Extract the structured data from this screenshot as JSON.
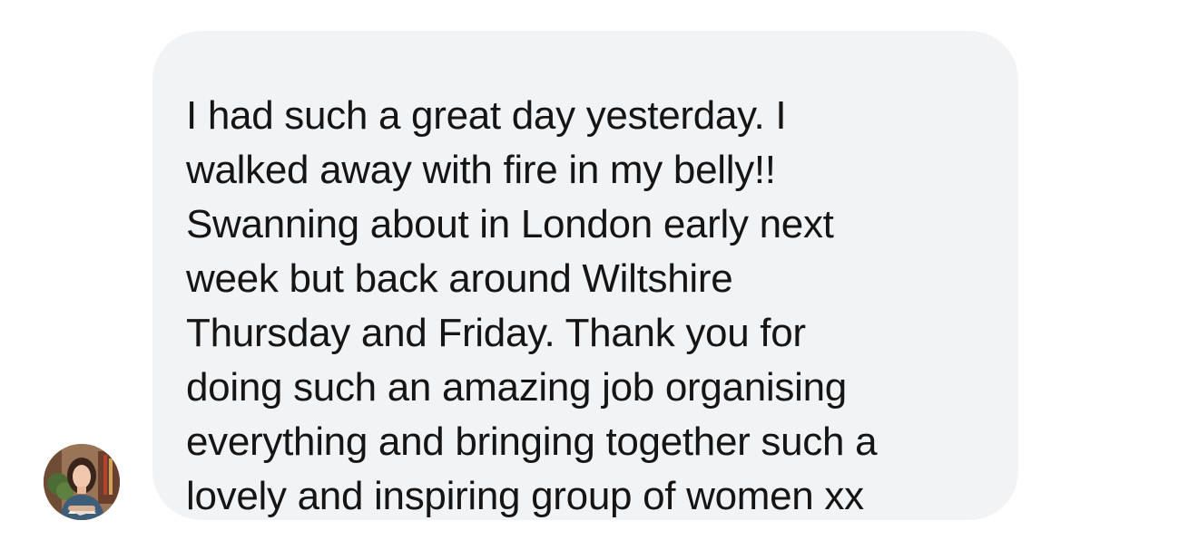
{
  "conversation": {
    "message": {
      "text": "I had such a great day yesterday. I\nwalked away with fire in my belly!!\nSwanning about in London early next\nweek but back around Wiltshire\nThursday and Friday. Thank you for\ndoing such an amazing job organising\neverything and bringing together such a\nlovely and inspiring group of women xx",
      "bubble_color": "#f2f3f5",
      "text_color": "#151515"
    },
    "sender": {
      "avatar_icon": "profile-photo-icon"
    }
  }
}
